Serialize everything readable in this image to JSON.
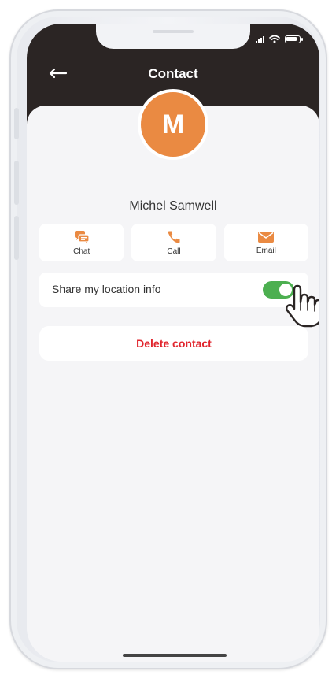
{
  "header": {
    "title": "Contact",
    "back_icon": "arrow-left-icon"
  },
  "status_bar": {
    "icons": [
      "signal-icon",
      "wifi-icon",
      "battery-icon"
    ]
  },
  "contact": {
    "initial": "M",
    "name": "Michel Samwell",
    "avatar_color": "#ea8a42"
  },
  "actions": [
    {
      "label": "Chat",
      "icon": "chat-icon"
    },
    {
      "label": "Call",
      "icon": "phone-icon"
    },
    {
      "label": "Email",
      "icon": "email-icon"
    }
  ],
  "location_share": {
    "label": "Share my location info",
    "enabled": true,
    "toggle_color": "#4caf50"
  },
  "delete": {
    "label": "Delete contact",
    "color": "#e1252d"
  },
  "colors": {
    "header_bg": "#2b2524",
    "accent": "#ea8a42",
    "background": "#f5f5f7"
  }
}
